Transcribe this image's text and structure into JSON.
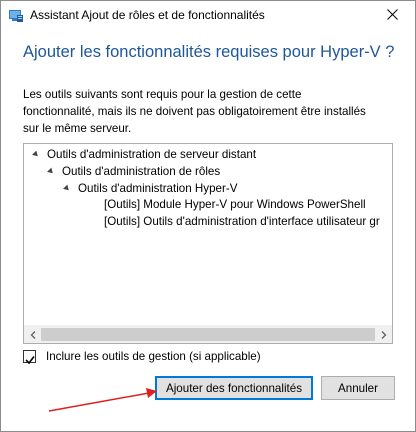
{
  "window": {
    "title": "Assistant Ajout de rôles et de fonctionnalités"
  },
  "dialog": {
    "heading": "Ajouter les fonctionnalités requises pour Hyper-V ?",
    "description": [
      "Les outils suivants sont requis pour la gestion de cette",
      "fonctionnalité, mais ils ne doivent pas obligatoirement être installés",
      "sur le même serveur."
    ]
  },
  "tree": {
    "items": [
      {
        "label": "Outils d'administration de serveur distant",
        "level": 0,
        "expanded": true
      },
      {
        "label": "Outils d'administration de rôles",
        "level": 1,
        "expanded": true
      },
      {
        "label": "Outils d'administration Hyper-V",
        "level": 2,
        "expanded": true
      },
      {
        "label": "[Outils] Module Hyper-V pour Windows PowerShell",
        "level": 3
      },
      {
        "label": "[Outils] Outils d'administration d'interface utilisateur gr",
        "level": 3
      }
    ]
  },
  "checkbox": {
    "label": "Inclure les outils de gestion (si applicable)",
    "checked": true
  },
  "buttons": {
    "add_label": "Ajouter des fonctionnalités",
    "cancel_label": "Annuler"
  },
  "colors": {
    "heading": "#1e5799",
    "focus_border": "#0078d7",
    "annotation_arrow": "#e02020"
  },
  "icons": {
    "title": "server-manager-icon",
    "close": "close-icon",
    "expand": "expanded-triangle-icon",
    "scroll_left": "chevron-left-icon",
    "scroll_right": "chevron-right-icon",
    "check": "checkmark-icon"
  }
}
